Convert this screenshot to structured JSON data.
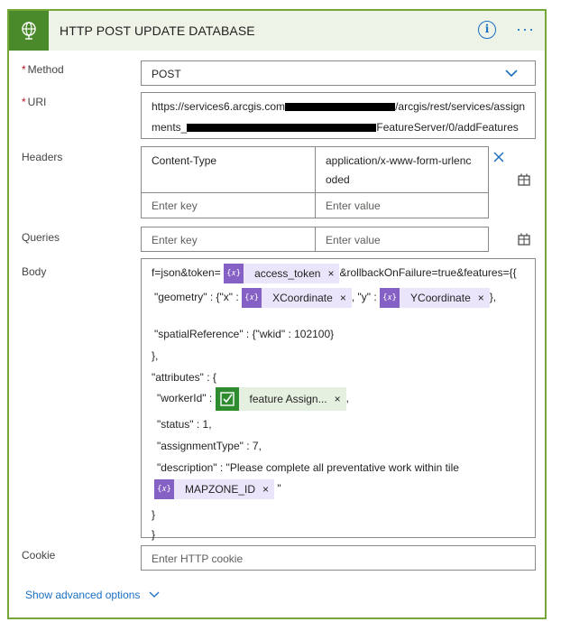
{
  "header": {
    "title": "HTTP POST UPDATE DATABASE",
    "info_glyph": "i",
    "more_glyph": "···"
  },
  "fields": {
    "method_label": "Method",
    "required_mark": "*",
    "method_value": "POST",
    "uri_label": "URI",
    "uri_line1_start": "https://services6.arcgis.com",
    "uri_line1_end": "/arcgis/rest/services/assign",
    "uri_line2_start": "ments_",
    "uri_line2_end": "FeatureServer/0/addFeatures",
    "headers_label": "Headers",
    "header_key": "Content-Type",
    "header_value_line1": "application/x-www-form-urlenc",
    "header_value_line2": "oded",
    "enter_key": "Enter key",
    "enter_value": "Enter value",
    "queries_label": "Queries",
    "body_label": "Body",
    "cookie_label": "Cookie",
    "cookie_placeholder": "Enter HTTP cookie"
  },
  "body": {
    "l1_pre": "f=json&token=",
    "l1_post": "&rollbackOnFailure=true&features={{",
    "l2_pre": "\"geometry\" : {\"x\" :",
    "l2_mid": ", \"y\" :",
    "l2_post": "},",
    "l3": "\"spatialReference\" : {\"wkid\" : 102100}",
    "l4": "},",
    "l5": "\"attributes\" : {",
    "l6_pre": "\"workerId\" :",
    "l6_post": ",",
    "l7": "\"status\" : 1,",
    "l8": "\"assignmentType\" : 7,",
    "l9": "\"description\" : \"Please complete all preventative work within tile",
    "l10_post": "\"",
    "l11": "}",
    "l12": "}"
  },
  "tokens": {
    "expr_glyph": "{𝑥}",
    "remove_glyph": "×",
    "access_token": "access_token",
    "x_coord": "XCoordinate",
    "y_coord": "YCoordinate",
    "feature": "feature Assign...",
    "mapzone": "MAPZONE_ID"
  },
  "footer": {
    "advanced_label": "Show advanced options"
  },
  "colors": {
    "accent_green": "#74a839",
    "icon_green": "#4a8a2a",
    "link_blue": "#1a6fc4",
    "token_purple": "#8661c5"
  },
  "icons": [
    "globe-icon",
    "info-icon",
    "more-icon",
    "chevron-down-icon",
    "close-icon",
    "switch-to-text-icon",
    "expression-icon",
    "checkbox-list-icon"
  ]
}
